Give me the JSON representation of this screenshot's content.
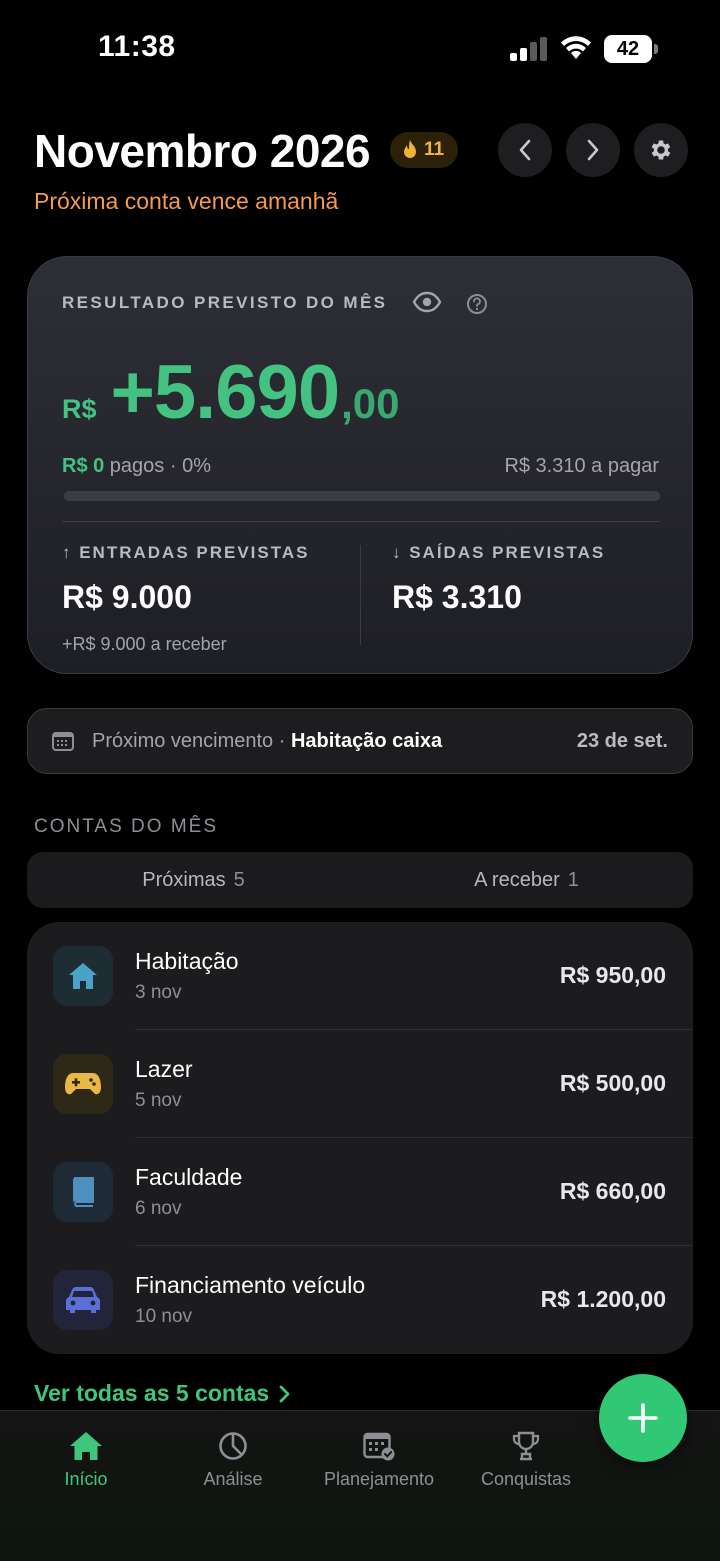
{
  "status_bar": {
    "time": "11:38",
    "battery": "42"
  },
  "header": {
    "title": "Novembro 2026",
    "streak": "11",
    "subtitle": "Próxima conta vence amanhã"
  },
  "summary": {
    "label": "RESULTADO PREVISTO DO MÊS",
    "currency": "R$",
    "amount": "+5.690",
    "cents": ",00",
    "paid_amount": "R$ 0",
    "paid_text": " pagos · 0%",
    "paid_fraction": 0,
    "to_pay": "R$ 3.310 a pagar",
    "income": {
      "label": "↑ ENTRADAS PREVISTAS",
      "value": "R$ 9.000",
      "sub": "+R$ 9.000 a receber"
    },
    "expenses": {
      "label": "↓ SAÍDAS PREVISTAS",
      "value": "R$ 3.310"
    }
  },
  "next_due": {
    "prefix": "Próximo vencimento · ",
    "name": "Habitação caixa",
    "date": "23 de set."
  },
  "section_title": "CONTAS DO MÊS",
  "tabs": [
    {
      "label": "Próximas",
      "count": "5"
    },
    {
      "label": "A receber",
      "count": "1"
    }
  ],
  "bills": [
    {
      "name": "Habitação",
      "date": "3 nov",
      "value": "R$ 950,00",
      "icon": "house-icon",
      "color": "#4aa3c7"
    },
    {
      "name": "Lazer",
      "date": "5 nov",
      "value": "R$ 500,00",
      "icon": "gamepad-icon",
      "color": "#e8b744"
    },
    {
      "name": "Faculdade",
      "date": "6 nov",
      "value": "R$ 660,00",
      "icon": "book-icon",
      "color": "#4f8fbf"
    },
    {
      "name": "Financiamento veículo",
      "date": "10 nov",
      "value": "R$ 1.200,00",
      "icon": "car-icon",
      "color": "#5b6fd6"
    }
  ],
  "see_all": "Ver todas as 5 contas",
  "bottom_nav": [
    {
      "label": "Início",
      "icon": "home-icon",
      "active": true
    },
    {
      "label": "Análise",
      "icon": "pie-chart-icon",
      "active": false
    },
    {
      "label": "Planejamento",
      "icon": "calendar-check-icon",
      "active": false
    },
    {
      "label": "Conquistas",
      "icon": "trophy-icon",
      "active": false
    }
  ],
  "colors": {
    "accent_green": "#44c281",
    "warning_orange": "#f39a52",
    "streak_gold": "#f0b33a"
  }
}
